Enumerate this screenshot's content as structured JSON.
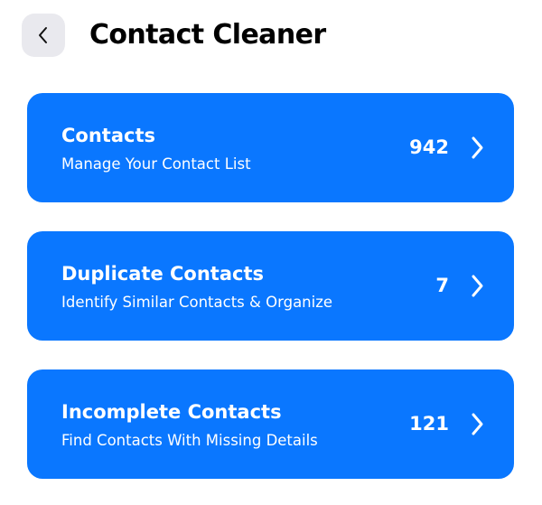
{
  "header": {
    "title": "Contact Cleaner",
    "back_icon": "chevron-left-icon"
  },
  "cards": [
    {
      "title": "Contacts",
      "subtitle": "Manage Your Contact List",
      "count": "942",
      "icon": "chevron-right-icon"
    },
    {
      "title": "Duplicate Contacts",
      "subtitle": "Identify Similar Contacts & Organize",
      "count": "7",
      "icon": "chevron-right-icon"
    },
    {
      "title": "Incomplete Contacts",
      "subtitle": "Find Contacts With Missing Details",
      "count": "121",
      "icon": "chevron-right-icon"
    }
  ],
  "colors": {
    "accent": "#0a77ff",
    "back_button_bg": "#e9e9ee",
    "text_on_accent": "#ffffff"
  }
}
